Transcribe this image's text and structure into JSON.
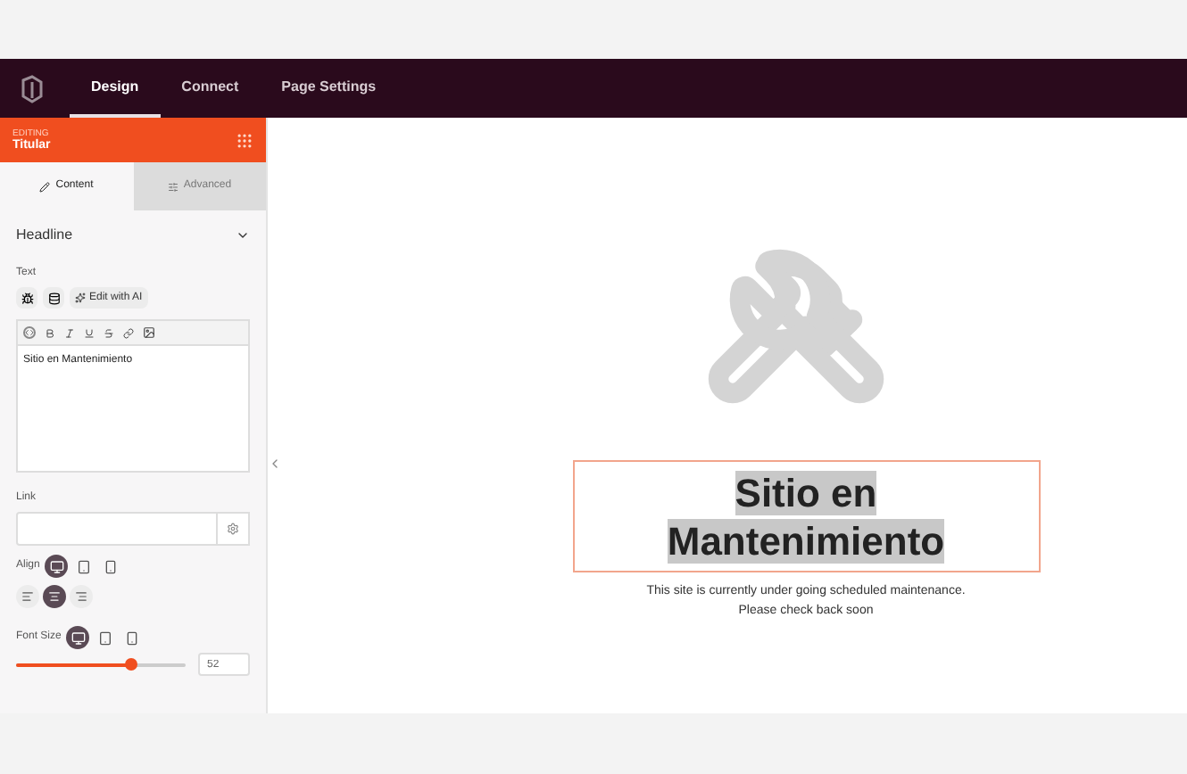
{
  "nav": {
    "tabs": [
      {
        "label": "Design",
        "selected": true
      },
      {
        "label": "Connect",
        "selected": false
      },
      {
        "label": "Page Settings",
        "selected": false
      }
    ]
  },
  "panel": {
    "editing_label": "EDITING",
    "element_name": "Titular",
    "tabs": [
      {
        "label": "Content",
        "selected": true
      },
      {
        "label": "Advanced",
        "selected": false
      }
    ],
    "section": {
      "title": "Headline",
      "expanded": true
    },
    "text_label": "Text",
    "ai_button": "Edit with AI",
    "editor_value": "Sitio en Mantenimiento",
    "link_label": "Link",
    "align_label": "Align",
    "devices": [
      {
        "kind": "desktop",
        "selected": true
      },
      {
        "kind": "tablet",
        "selected": false
      },
      {
        "kind": "phone",
        "selected": false
      }
    ],
    "alignments": [
      {
        "kind": "left",
        "selected": false
      },
      {
        "kind": "center",
        "selected": true
      },
      {
        "kind": "right",
        "selected": false
      }
    ],
    "font_size_label": "Font Size",
    "font_devices": [
      {
        "kind": "desktop",
        "selected": true
      },
      {
        "kind": "tablet",
        "selected": false
      },
      {
        "kind": "phone",
        "selected": false
      }
    ],
    "font_size": {
      "level": 0.68,
      "value": "52"
    }
  },
  "canvas": {
    "headline": "Sitio en Mantenimiento",
    "message": [
      "This site is currently under going scheduled maintenance.",
      "Please check back soon"
    ]
  }
}
